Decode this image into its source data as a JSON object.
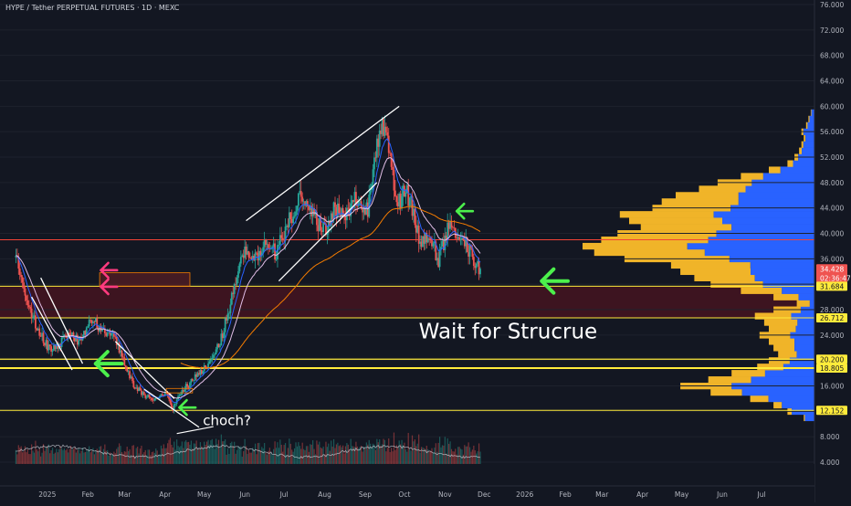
{
  "header": {
    "symbol_line": "HYPE / Tether PERPETUAL FUTURES · 1D · MEXC"
  },
  "colors": {
    "background": "#131722",
    "up": "#26a69a",
    "down": "#ef5350",
    "ema_fast": "#2962ff",
    "ema_mid": "#e1bee7",
    "ema_slow": "#f57c00",
    "level_yellow": "#ffeb3b",
    "level_red": "#f44336",
    "arrow_green": "#4cf04c",
    "arrow_pink": "#ff3b7f",
    "vp_up": "#f0b429",
    "vp_down": "#2962ff"
  },
  "annotations": {
    "wait_label": "Wait for Strucrue",
    "choch_label": "choch?"
  },
  "chart_data": {
    "type": "candlestick",
    "y_axis": {
      "ticks": [
        4,
        8,
        12,
        16,
        20,
        24,
        28,
        32,
        36,
        40,
        44,
        48,
        52,
        56,
        60,
        64,
        68,
        72,
        76
      ],
      "tick_labels": [
        "4.000",
        "8.000",
        "12.000",
        "16.000",
        "20.000",
        "24.000",
        "28.000",
        "32.000",
        "36.000",
        "40.000",
        "44.000",
        "48.000",
        "52.000",
        "56.000",
        "60.000",
        "64.000",
        "68.000",
        "72.000",
        "76.000"
      ],
      "ylim": [
        4,
        76
      ]
    },
    "x_axis": {
      "labels": [
        "2025",
        "Feb",
        "Mar",
        "Apr",
        "May",
        "Jun",
        "Jul",
        "Aug",
        "Sep",
        "Oct",
        "Nov",
        "Dec",
        "2026",
        "Feb",
        "Mar",
        "Apr",
        "May",
        "Jun",
        "Jul"
      ],
      "first_date": "2025-01-01",
      "xlim": [
        "2024-12-07",
        "2026-07-31"
      ]
    },
    "key_points": [
      {
        "date": "2024-12-08",
        "close": 36.2
      },
      {
        "date": "2024-12-15",
        "close": 30.5
      },
      {
        "date": "2024-12-24",
        "close": 25.0
      },
      {
        "date": "2025-01-02",
        "close": 22.0
      },
      {
        "date": "2025-01-10",
        "close": 22.5
      },
      {
        "date": "2025-01-18",
        "close": 24.5
      },
      {
        "date": "2025-01-25",
        "close": 23.0
      },
      {
        "date": "2025-02-03",
        "close": 26.5
      },
      {
        "date": "2025-02-12",
        "close": 25.0
      },
      {
        "date": "2025-02-20",
        "close": 24.0
      },
      {
        "date": "2025-02-27",
        "close": 20.5
      },
      {
        "date": "2025-03-08",
        "close": 16.0
      },
      {
        "date": "2025-03-16",
        "close": 14.5
      },
      {
        "date": "2025-03-24",
        "close": 13.8
      },
      {
        "date": "2025-04-02",
        "close": 14.6
      },
      {
        "date": "2025-04-07",
        "close": 12.3
      },
      {
        "date": "2025-04-14",
        "close": 15.2
      },
      {
        "date": "2025-04-25",
        "close": 17.5
      },
      {
        "date": "2025-05-05",
        "close": 19.5
      },
      {
        "date": "2025-05-15",
        "close": 24.0
      },
      {
        "date": "2025-05-26",
        "close": 33.5
      },
      {
        "date": "2025-06-01",
        "close": 38.0
      },
      {
        "date": "2025-06-08",
        "close": 36.0
      },
      {
        "date": "2025-06-16",
        "close": 38.5
      },
      {
        "date": "2025-06-25",
        "close": 37.0
      },
      {
        "date": "2025-07-05",
        "close": 42.0
      },
      {
        "date": "2025-07-14",
        "close": 46.5
      },
      {
        "date": "2025-07-22",
        "close": 43.0
      },
      {
        "date": "2025-08-01",
        "close": 40.5
      },
      {
        "date": "2025-08-08",
        "close": 44.0
      },
      {
        "date": "2025-08-16",
        "close": 42.5
      },
      {
        "date": "2025-08-25",
        "close": 45.5
      },
      {
        "date": "2025-09-03",
        "close": 44.0
      },
      {
        "date": "2025-09-10",
        "close": 54.0
      },
      {
        "date": "2025-09-17",
        "close": 57.5
      },
      {
        "date": "2025-09-20",
        "close": 51.0
      },
      {
        "date": "2025-09-26",
        "close": 44.5
      },
      {
        "date": "2025-10-02",
        "close": 47.0
      },
      {
        "date": "2025-10-08",
        "close": 43.0
      },
      {
        "date": "2025-10-13",
        "close": 38.5
      },
      {
        "date": "2025-10-20",
        "close": 39.5
      },
      {
        "date": "2025-10-27",
        "close": 36.0
      },
      {
        "date": "2025-11-04",
        "close": 41.0
      },
      {
        "date": "2025-11-11",
        "close": 39.0
      },
      {
        "date": "2025-11-18",
        "close": 38.0
      },
      {
        "date": "2025-11-24",
        "close": 35.0
      },
      {
        "date": "2025-11-28",
        "close": 34.428
      }
    ],
    "indicators": [
      {
        "name": "",
        "period": 9,
        "color_key": "ema_fast"
      },
      {
        "name": "",
        "period": 21,
        "color_key": "ema_mid"
      },
      {
        "name": "",
        "period": 100,
        "color_key": "ema_slow"
      }
    ],
    "horizontal_levels": [
      {
        "value": 39.0,
        "color_key": "level_red",
        "width": 1
      },
      {
        "value": 31.684,
        "color_key": "level_yellow",
        "width": 1
      },
      {
        "value": 26.712,
        "color_key": "level_yellow",
        "width": 1
      },
      {
        "value": 20.2,
        "color_key": "level_yellow",
        "width": 1.2
      },
      {
        "value": 18.805,
        "color_key": "level_yellow",
        "width": 2
      },
      {
        "value": 12.152,
        "color_key": "level_yellow",
        "width": 1
      }
    ],
    "zones": [
      {
        "from": 26.712,
        "to": 31.684,
        "color": "#3d1420"
      }
    ],
    "price_tags": [
      {
        "label": "34.428",
        "sub": "02:36:47",
        "value": 34.428,
        "bg": "#ef5350",
        "fg": "#ffffff"
      },
      {
        "label": "31.684",
        "value": 31.684,
        "bg": "#ffeb3b",
        "fg": "#131722"
      },
      {
        "label": "26.712",
        "value": 26.712,
        "bg": "#ffeb3b",
        "fg": "#131722"
      },
      {
        "label": "20.200",
        "value": 20.2,
        "bg": "#ffeb3b",
        "fg": "#131722"
      },
      {
        "label": "18.805",
        "value": 18.805,
        "bg": "#ffeb3b",
        "fg": "#131722"
      },
      {
        "label": "12.152",
        "value": 12.152,
        "bg": "#ffeb3b",
        "fg": "#131722"
      }
    ],
    "trendlines": [
      {
        "from": [
          "2024-12-20",
          30.0
        ],
        "to": [
          "2025-01-20",
          18.5
        ]
      },
      {
        "from": [
          "2024-12-27",
          33.0
        ],
        "to": [
          "2025-01-28",
          19.5
        ]
      },
      {
        "from": [
          "2025-02-22",
          23.0
        ],
        "to": [
          "2025-04-08",
          14.0
        ]
      },
      {
        "from": [
          "2025-03-16",
          15.5
        ],
        "to": [
          "2025-04-27",
          9.5
        ]
      },
      {
        "from": [
          "2025-06-02",
          42.0
        ],
        "to": [
          "2025-09-27",
          60.0
        ]
      },
      {
        "from": [
          "2025-06-27",
          32.5
        ],
        "to": [
          "2025-09-10",
          48.0
        ]
      }
    ],
    "rectangles": [
      {
        "from": [
          "2025-02-10",
          33.8
        ],
        "to": [
          "2025-04-20",
          31.7
        ],
        "stroke": "#f57c00",
        "fill": "#5a1e24"
      },
      {
        "from": [
          "2025-04-02",
          15.6
        ],
        "to": [
          "2025-04-22",
          14.9
        ],
        "stroke": "#f57c00",
        "fill": "none"
      }
    ],
    "arrows": [
      {
        "at": [
          "2025-02-11",
          34.2
        ],
        "dir": "left",
        "color_key": "arrow_pink",
        "size": "small"
      },
      {
        "at": [
          "2025-02-11",
          31.6
        ],
        "dir": "left",
        "color_key": "arrow_pink",
        "size": "small"
      },
      {
        "at": [
          "2025-02-07",
          19.5
        ],
        "dir": "left",
        "color_key": "arrow_green",
        "size": "large"
      },
      {
        "at": [
          "2025-04-12",
          12.6
        ],
        "dir": "left",
        "color_key": "arrow_green",
        "size": "small"
      },
      {
        "at": [
          "2025-11-10",
          43.5
        ],
        "dir": "left",
        "color_key": "arrow_green",
        "size": "small"
      },
      {
        "at": [
          "2026-01-14",
          32.5
        ],
        "dir": "left",
        "color_key": "arrow_green",
        "size": "large"
      }
    ],
    "annotation_positions": {
      "wait": [
        "2025-10-12",
        23.5
      ],
      "choch": [
        "2025-04-30",
        9.8
      ]
    },
    "volume_profile": [
      [
        11,
        0.05,
        0.9
      ],
      [
        12,
        0.12,
        0.85
      ],
      [
        13,
        0.18,
        0.8
      ],
      [
        14,
        0.28,
        0.72
      ],
      [
        15,
        0.45,
        0.7
      ],
      [
        16,
        0.58,
        0.62
      ],
      [
        17,
        0.46,
        0.6
      ],
      [
        18,
        0.36,
        0.6
      ],
      [
        19,
        0.25,
        0.55
      ],
      [
        20,
        0.2,
        0.55
      ],
      [
        21,
        0.16,
        0.5
      ],
      [
        22,
        0.18,
        0.5
      ],
      [
        23,
        0.2,
        0.45
      ],
      [
        24,
        0.24,
        0.45
      ],
      [
        25,
        0.2,
        0.42
      ],
      [
        26,
        0.22,
        0.35
      ],
      [
        27,
        0.26,
        0.4
      ],
      [
        28,
        0.18,
        0.35
      ],
      [
        29,
        0.08,
        0.3
      ],
      [
        30,
        0.18,
        0.4
      ],
      [
        31,
        0.32,
        0.45
      ],
      [
        32,
        0.45,
        0.5
      ],
      [
        33,
        0.52,
        0.5
      ],
      [
        34,
        0.58,
        0.48
      ],
      [
        35,
        0.62,
        0.45
      ],
      [
        36,
        0.82,
        0.45
      ],
      [
        37,
        0.95,
        0.5
      ],
      [
        38,
        1.0,
        0.55
      ],
      [
        39,
        0.92,
        0.5
      ],
      [
        40,
        0.85,
        0.5
      ],
      [
        41,
        0.75,
        0.48
      ],
      [
        42,
        0.8,
        0.5
      ],
      [
        43,
        0.84,
        0.52
      ],
      [
        44,
        0.7,
        0.52
      ],
      [
        45,
        0.66,
        0.5
      ],
      [
        46,
        0.6,
        0.55
      ],
      [
        47,
        0.5,
        0.6
      ],
      [
        48,
        0.42,
        0.65
      ],
      [
        49,
        0.32,
        0.7
      ],
      [
        50,
        0.2,
        0.75
      ],
      [
        51,
        0.12,
        0.8
      ],
      [
        52,
        0.09,
        0.82
      ],
      [
        53,
        0.07,
        0.84
      ],
      [
        54,
        0.06,
        0.86
      ],
      [
        55,
        0.05,
        0.85
      ],
      [
        56,
        0.06,
        0.86
      ],
      [
        57,
        0.04,
        0.84
      ],
      [
        58,
        0.03,
        0.85
      ],
      [
        59,
        0.02,
        0.85
      ]
    ]
  }
}
